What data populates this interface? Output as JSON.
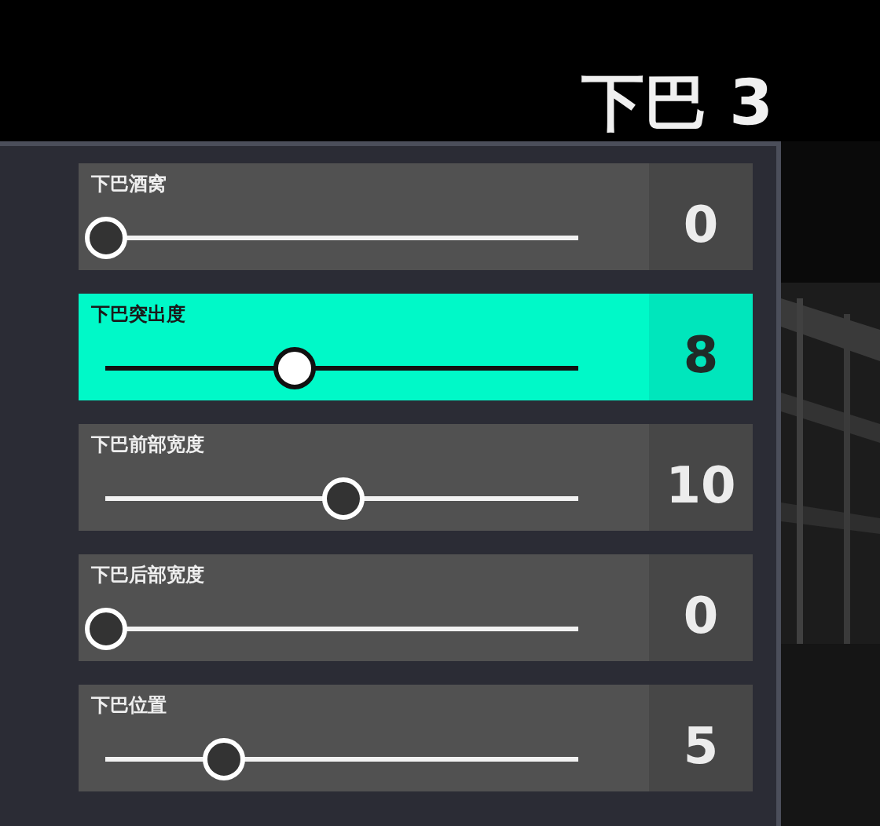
{
  "title": "下巴 3",
  "sliders": [
    {
      "label": "下巴酒窝",
      "value": "0",
      "level": 0,
      "selected": false
    },
    {
      "label": "下巴突出度",
      "value": "8",
      "level": 0.4,
      "selected": true
    },
    {
      "label": "下巴前部宽度",
      "value": "10",
      "level": 0.5,
      "selected": false
    },
    {
      "label": "下巴后部宽度",
      "value": "0",
      "level": 0,
      "selected": false
    },
    {
      "label": "下巴位置",
      "value": "5",
      "level": 0.25,
      "selected": false
    }
  ]
}
